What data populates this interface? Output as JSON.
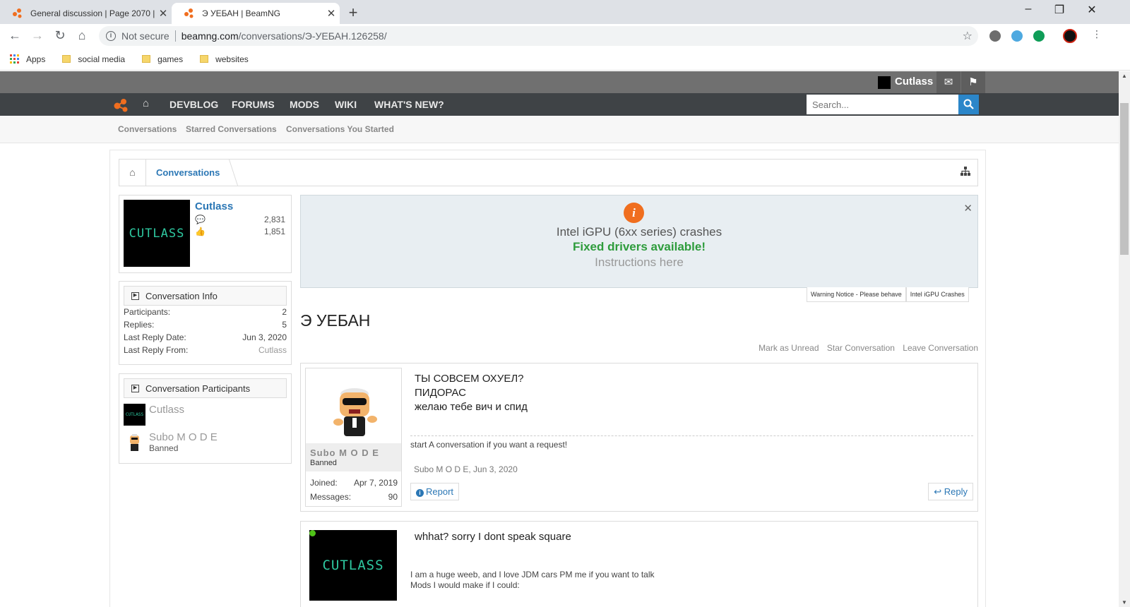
{
  "browser": {
    "tabs": [
      {
        "title": "General discussion | Page 2070 |",
        "close": "✕"
      },
      {
        "title": "Э УЕБАН | BeamNG",
        "close": "✕"
      }
    ],
    "new_tab": "+",
    "window_controls": {
      "minimize": "–",
      "restore": "❐",
      "close": "✕"
    },
    "nav": {
      "back": "←",
      "forward": "→",
      "reload": "↻",
      "home": "⌂"
    },
    "address": {
      "security": "Not secure",
      "host": "beamng.com",
      "path": "/conversations/Э-УЕБАН.126258/"
    },
    "bookmarks": [
      "Apps",
      "social media",
      "games",
      "websites"
    ]
  },
  "site": {
    "user": {
      "name": "Cutlass",
      "avatar_text": "CUTLASS"
    },
    "nav": [
      "DEVBLOG",
      "FORUMS",
      "MODS",
      "WIKI",
      "WHAT'S NEW?"
    ],
    "search_placeholder": "Search...",
    "subnav": [
      "Conversations",
      "Starred Conversations",
      "Conversations You Started"
    ],
    "breadcrumb": "Conversations"
  },
  "visitor": {
    "name": "Cutlass",
    "avatar_text": "CUTLASS",
    "messages": "2,831",
    "likes": "1,851"
  },
  "conversation_info": {
    "heading": "Conversation Info",
    "rows": [
      {
        "label": "Participants:",
        "value": "2"
      },
      {
        "label": "Replies:",
        "value": "5"
      },
      {
        "label": "Last Reply Date:",
        "value": "Jun 3, 2020"
      },
      {
        "label": "Last Reply From:",
        "value": "Cutlass"
      }
    ]
  },
  "participants": {
    "heading": "Conversation Participants",
    "list": [
      {
        "name": "Cutlass",
        "title": "",
        "avatar_text": "CUTLASS"
      },
      {
        "name": "Subo M O D E",
        "title": "Banned"
      }
    ]
  },
  "notice": {
    "icon": "i",
    "line1": "Intel iGPU (6xx series) crashes",
    "line2": "Fixed drivers available!",
    "line3": "Instructions here",
    "close": "✕",
    "tabs": [
      "Warning Notice - Please behave",
      "Intel iGPU Crashes"
    ]
  },
  "conversation": {
    "title": "Э УЕБАН",
    "actions": [
      "Mark as Unread",
      "Star Conversation",
      "Leave Conversation"
    ]
  },
  "messages": [
    {
      "author": "Subo M O D E",
      "author_title": "Banned",
      "joined_label": "Joined:",
      "joined": "Apr 7, 2019",
      "messages_label": "Messages:",
      "message_count": "90",
      "lines": [
        "ТЫ СОВСЕМ ОХУЕЛ?",
        "ПИДОРАС",
        "желаю тебе вич и спид"
      ],
      "signature": "start A conversation if you want a request!",
      "meta": "Subo M O D E, Jun 3, 2020",
      "report": "Report",
      "reply": "Reply"
    },
    {
      "author_avatar_text": "CUTLASS",
      "lines": [
        "whhat? sorry I dont speak square"
      ],
      "signature_lines": [
        "I am a huge weeb, and I love JDM cars PM me if you want to talk",
        "Mods I would make if I could:"
      ]
    }
  ],
  "colors": {
    "accent": "#2b77b5",
    "navbar": "#3f4346",
    "userbar": "#707070",
    "brand_orange": "#f06e1f",
    "notice_green": "#2e9c3c"
  }
}
